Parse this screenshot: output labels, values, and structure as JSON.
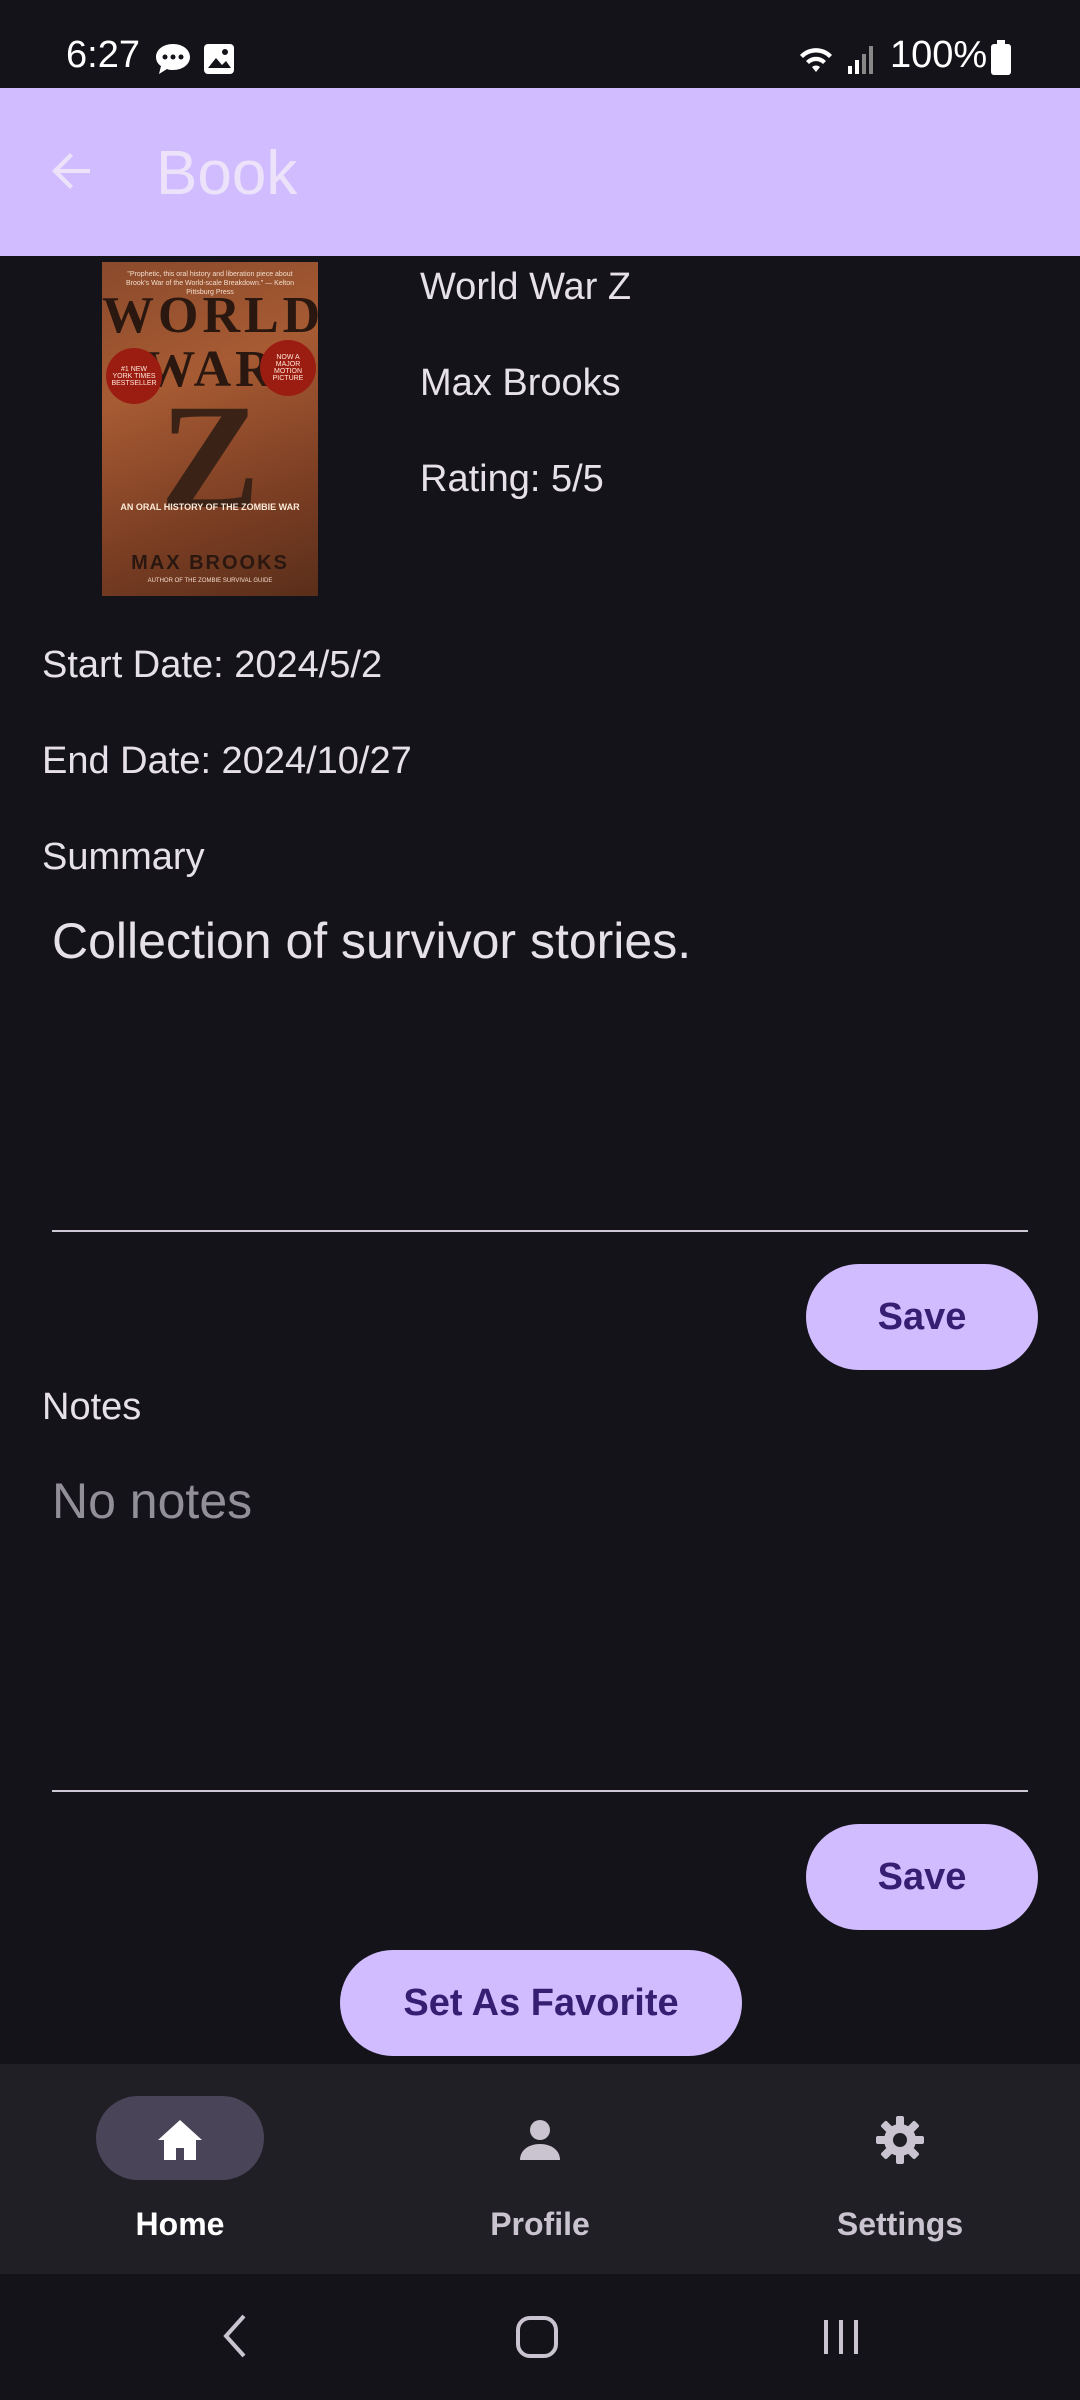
{
  "status_bar": {
    "time": "6:27",
    "battery": "100%",
    "icons": [
      "message-icon",
      "image-icon",
      "wifi-icon",
      "signal-icon",
      "battery-icon"
    ]
  },
  "app_bar": {
    "title": "Book",
    "back_icon": "arrow-back-icon",
    "background": "#d0bcff"
  },
  "cover": {
    "tagline": "\"Prophetic, this oral history and liberation piece about Brook's War of the World-scale Breakdown.\" — Kelton Pittsburg Press",
    "title_line1": "WORLD",
    "title_line2": "WAR",
    "title_z": "Z",
    "seal_left": "#1 NEW YORK TIMES BESTSELLER",
    "seal_right": "NOW A MAJOR MOTION PICTURE",
    "subtitle": "AN ORAL HISTORY OF THE ZOMBIE WAR",
    "author": "MAX BROOKS",
    "footer": "AUTHOR OF THE ZOMBIE SURVIVAL GUIDE"
  },
  "book": {
    "title": "World War Z",
    "author": "Max Brooks",
    "rating": "Rating: 5/5",
    "start_date": "Start Date: 2024/5/2",
    "end_date": "End Date: 2024/10/27"
  },
  "summary": {
    "label": "Summary",
    "value": "Collection of survivor stories.",
    "save_label": "Save"
  },
  "notes": {
    "label": "Notes",
    "placeholder": "No notes",
    "save_label": "Save"
  },
  "favorite_button": "Set As Favorite",
  "bottom_nav": {
    "items": [
      {
        "label": "Home",
        "icon": "home-icon",
        "selected": true
      },
      {
        "label": "Profile",
        "icon": "person-icon",
        "selected": false
      },
      {
        "label": "Settings",
        "icon": "gear-icon",
        "selected": false
      }
    ]
  },
  "system_nav": {
    "icons": [
      "back-icon",
      "home-circle-icon",
      "recents-icon"
    ]
  },
  "colors": {
    "background": "#15131a",
    "accent": "#d0bcff",
    "on_accent": "#381e72",
    "nav_background": "#211f26",
    "nav_pill": "#4a4458"
  }
}
